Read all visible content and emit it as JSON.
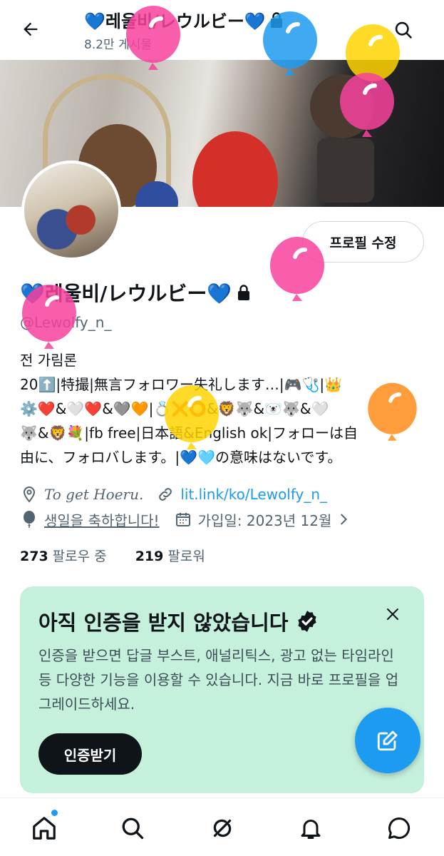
{
  "header": {
    "title": "💙레울비/レウルビー💙",
    "post_count": "8.2만 게시물"
  },
  "profile": {
    "edit_label": "프로필 수정",
    "name": "💙레울비/レウルビー💙",
    "handle": "@Lewolfy_n_",
    "bio_lines": [
      "전 가림론",
      "20⬆️|特撮|無言フォロワー失礼します…|🎮🩺|👑",
      "⚙️❤️&🤍❤️&🩶🧡|💍❌⭕&🦁🐺&🐻‍❄️🐺&🤍",
      "🐺&🦁💐|fb free|日本語&English ok|フォローは自",
      "由に、フォロバします。|💙🩵の意味はないです。"
    ],
    "location": "To get Hoeru.",
    "website": "lit.link/ko/Lewolfy_n_",
    "birthday": "생일을 축하합니다!",
    "joined": "가입일: 2023년 12월",
    "following_count": "273",
    "following_label": "팔로우 중",
    "followers_count": "219",
    "followers_label": "팔로워"
  },
  "verify_card": {
    "title": "아직 인증을 받지 않았습니다",
    "description": "인증을 받으면 답글 부스트, 애널리틱스, 광고 없는 타임라인 등 다양한 기능을 이용할 수 있습니다. 지금 바로 프로필을 업그레이드하세요.",
    "button": "인증받기"
  },
  "nav": {
    "items": [
      "home-icon",
      "search-icon",
      "grok-icon",
      "notifications-icon",
      "messages-icon"
    ]
  },
  "colors": {
    "accent": "#1d9bf0",
    "card_bg": "#c4f0dc",
    "balloon_pink": "#f7429d",
    "balloon_blue": "#1d9bf0",
    "balloon_yellow": "#ffd400",
    "balloon_orange": "#ff8c1a"
  }
}
